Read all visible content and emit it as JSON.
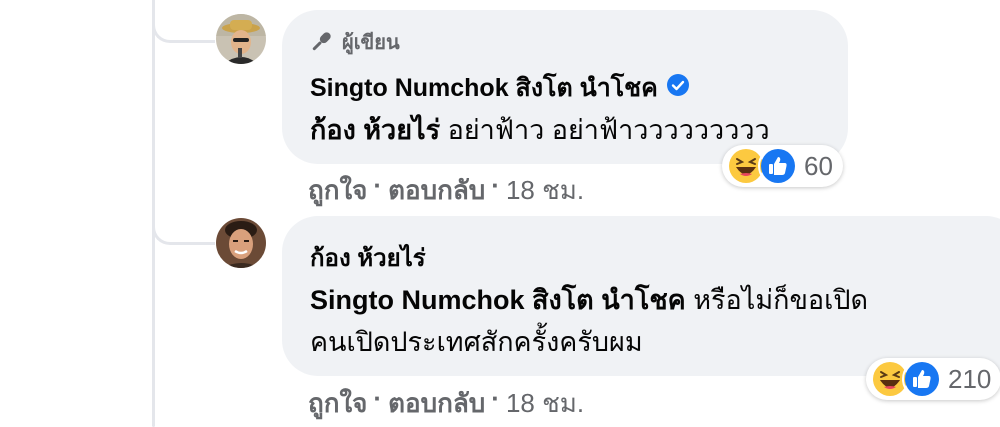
{
  "comments": [
    {
      "author_badge": "ผู้เขียน",
      "author_name": "Singto Numchok สิงโต นำโชค",
      "verified": true,
      "mention": "ก้อง ห้วยไร่",
      "text": "อย่าฟ้าว อย่าฟ้าววววววววว",
      "reaction_count": "60",
      "reaction_icons": [
        "haha-icon",
        "like-icon"
      ],
      "like_label": "ถูกใจ",
      "reply_label": "ตอบกลับ",
      "separator": "·",
      "time": "18 ชม."
    },
    {
      "author_name": "ก้อง ห้วยไร่",
      "mention": "Singto Numchok สิงโต นำโชค",
      "text_line1": "หรือไม่ก็ขอเปิด",
      "text_line2": "คนเปิดประเทศสักครั้งครับผม",
      "reaction_count": "210",
      "reaction_icons": [
        "haha-icon",
        "like-icon"
      ],
      "like_label": "ถูกใจ",
      "reply_label": "ตอบกลับ",
      "separator": "·",
      "time": "18 ชม."
    }
  ],
  "colors": {
    "bubble": "#f0f2f5",
    "muted_text": "#65676b",
    "like_blue": "#1877f2",
    "haha_yellow": "#fcc940",
    "thread_line": "#e4e6eb"
  }
}
